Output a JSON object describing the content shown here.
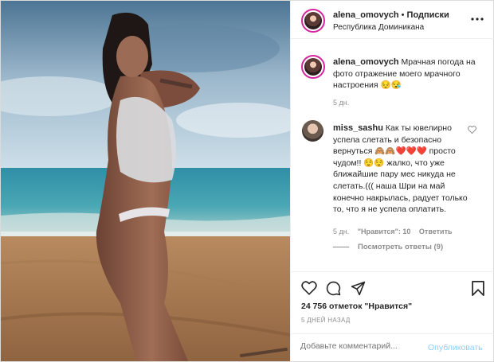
{
  "header": {
    "username": "alena_omovych",
    "separator": "•",
    "follow_label": "Подписки",
    "location": "Республика Доминикана",
    "more_icon": "more-horizontal-icon"
  },
  "caption": {
    "username": "alena_omovych",
    "text": "Мрачная погода на фото отражение моего мрачного настроения 😔😪",
    "time": "5 дн."
  },
  "comment": {
    "username": "miss_sashu",
    "text": "Как ты ювелирно успела слетать и безопасно вернуться 🙈🙈❤️❤️❤️ просто чудом!! 😌😌 жалко, что уже ближайшие пару мес никуда не слетать.((( наша Шри на май конечно накрылась, радует только то, что я не успела оплатить.",
    "time": "5 дн.",
    "likes": "\"Нравится\": 10",
    "reply_label": "Ответить",
    "view_replies": "Посмотреть ответы (9)"
  },
  "actions": {
    "like_icon": "heart-icon",
    "comment_icon": "comment-icon",
    "share_icon": "share-icon",
    "save_icon": "bookmark-icon",
    "likes_count": "24 756 отметок \"Нравится\"",
    "date": "5 ДНЕЙ НАЗАД"
  },
  "add_comment": {
    "placeholder": "Добавьте комментарий...",
    "publish_label": "Опубликовать"
  },
  "colors": {
    "link_blue": "#0095f6",
    "muted": "#8e8e8e",
    "border": "#efefef"
  }
}
